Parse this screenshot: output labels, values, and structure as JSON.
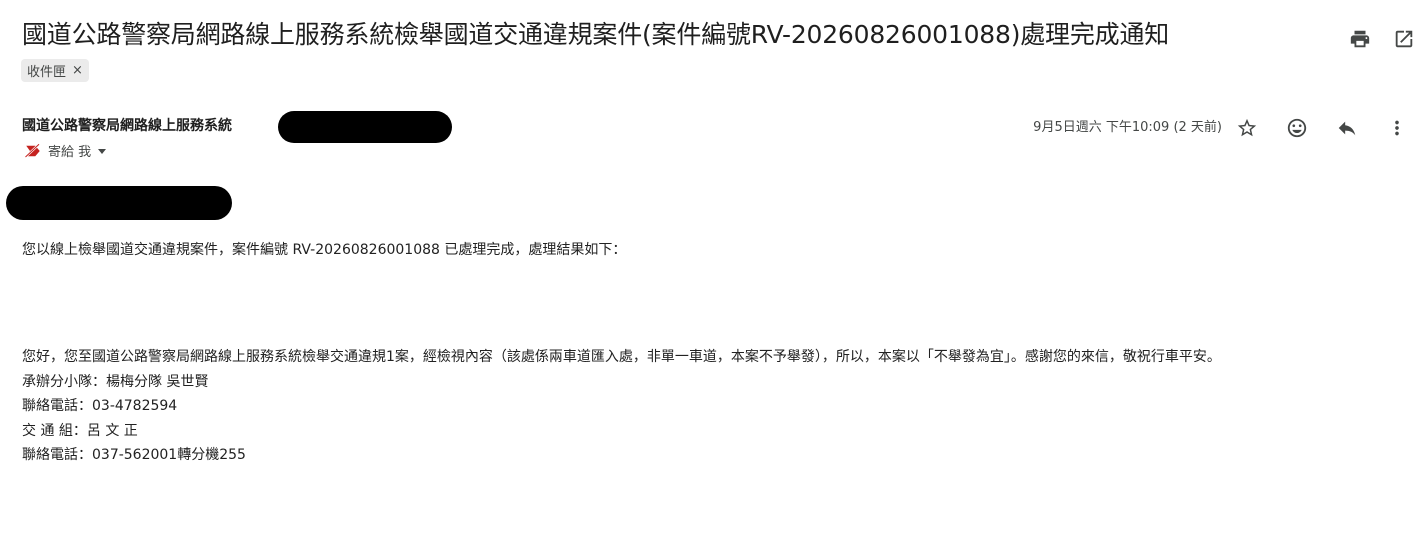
{
  "subject": "國道公路警察局網路線上服務系統檢舉國道交通違規案件(案件編號RV-20260826001088)處理完成通知",
  "label_chip": "收件匣",
  "label_chip_close": "×",
  "sender_name": "國道公路警察局網路線上服務系統",
  "date": "9月5日週六 下午10:09 (2 天前)",
  "to_text": "寄給 我",
  "body": {
    "intro": "您以線上檢舉國道交通違規案件，案件編號 RV-20260826001088 已處理完成，處理結果如下：",
    "main": "您好，您至國道公路警察局網路線上服務系統檢舉交通違規1案，經檢視內容（該處係兩車道匯入處，非單一車道，本案不予舉發），所以，本案以「不舉發為宜」。感謝您的來信，敬祝行車平安。",
    "officer_line": "承辦分小隊：楊梅分隊 吳世賢",
    "officer_phone": "聯絡電話：03-4782594",
    "traffic_line": "交 通 組：呂 文 正",
    "traffic_phone": "聯絡電話：037-562001轉分機255"
  },
  "icons": {
    "top": [
      "print-icon",
      "open-in-new-window-icon"
    ],
    "message": [
      "star-icon",
      "emoji-reaction-icon",
      "reply-icon",
      "more-vert-icon"
    ],
    "to_badge": "important-marker-icon",
    "caret": "caret-down-icon"
  },
  "colors": {
    "text": "#202124",
    "muted": "#444746",
    "chip_bg": "#ebebeb",
    "badge": "#c5221f"
  }
}
